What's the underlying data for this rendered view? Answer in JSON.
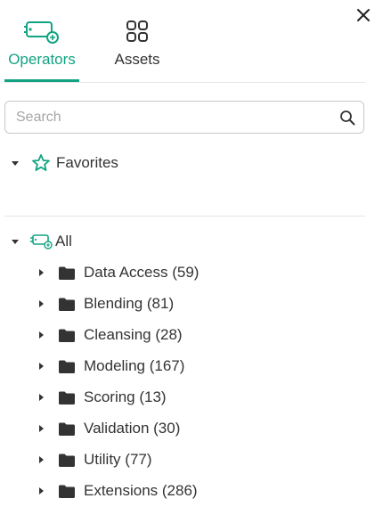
{
  "tabs": [
    {
      "label": "Operators",
      "active": true,
      "icon": "operators-icon"
    },
    {
      "label": "Assets",
      "active": false,
      "icon": "assets-grid-icon"
    }
  ],
  "search": {
    "placeholder": "Search",
    "value": ""
  },
  "favorites": {
    "label": "Favorites",
    "icon": "star-outline-icon",
    "expanded": true
  },
  "all": {
    "label": "All",
    "icon": "operators-icon",
    "expanded": true
  },
  "categories": [
    {
      "label": "Data Access (59)"
    },
    {
      "label": "Blending (81)"
    },
    {
      "label": "Cleansing (28)"
    },
    {
      "label": "Modeling (167)"
    },
    {
      "label": "Scoring (13)"
    },
    {
      "label": "Validation (30)"
    },
    {
      "label": "Utility (77)"
    },
    {
      "label": "Extensions (286)"
    }
  ],
  "colors": {
    "accent": "#12a383",
    "text": "#333333",
    "folder": "#333333"
  }
}
